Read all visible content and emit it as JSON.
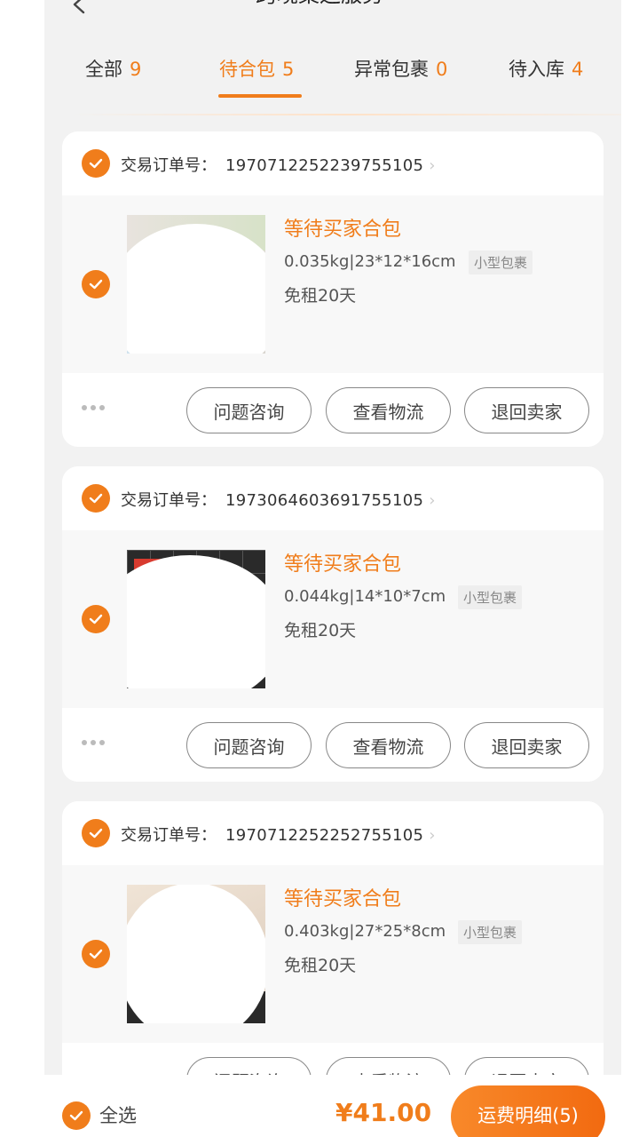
{
  "header": {
    "title": "跨境集运服务"
  },
  "tabs": [
    {
      "label": "全部",
      "count": "9"
    },
    {
      "label": "待合包",
      "count": "5"
    },
    {
      "label": "异常包裹",
      "count": "0"
    },
    {
      "label": "待入库",
      "count": "4"
    }
  ],
  "active_tab": "待合包",
  "order_prefix": "交易订单号：",
  "orders": [
    {
      "order_no": "1970712252239755105",
      "status": "等待买家合包",
      "spec": "0.035kg|23*12*16cm",
      "tag": "小型包裹",
      "free": "免租20天"
    },
    {
      "order_no": "1973064603691755105",
      "status": "等待买家合包",
      "spec": "0.044kg|14*10*7cm",
      "tag": "小型包裹",
      "free": "免租20天"
    },
    {
      "order_no": "1970712252252755105",
      "status": "等待买家合包",
      "spec": "0.403kg|27*25*8cm",
      "tag": "小型包裹",
      "free": "免租20天"
    }
  ],
  "actions": {
    "consult": "问题咨询",
    "logistics": "查看物流",
    "return": "退回卖家"
  },
  "footer": {
    "select_all": "全选",
    "total": "¥41.00",
    "fee_button": "运费明细(5)"
  },
  "colors": {
    "accent": "#f07d1b",
    "background": "#f2f2f2"
  }
}
